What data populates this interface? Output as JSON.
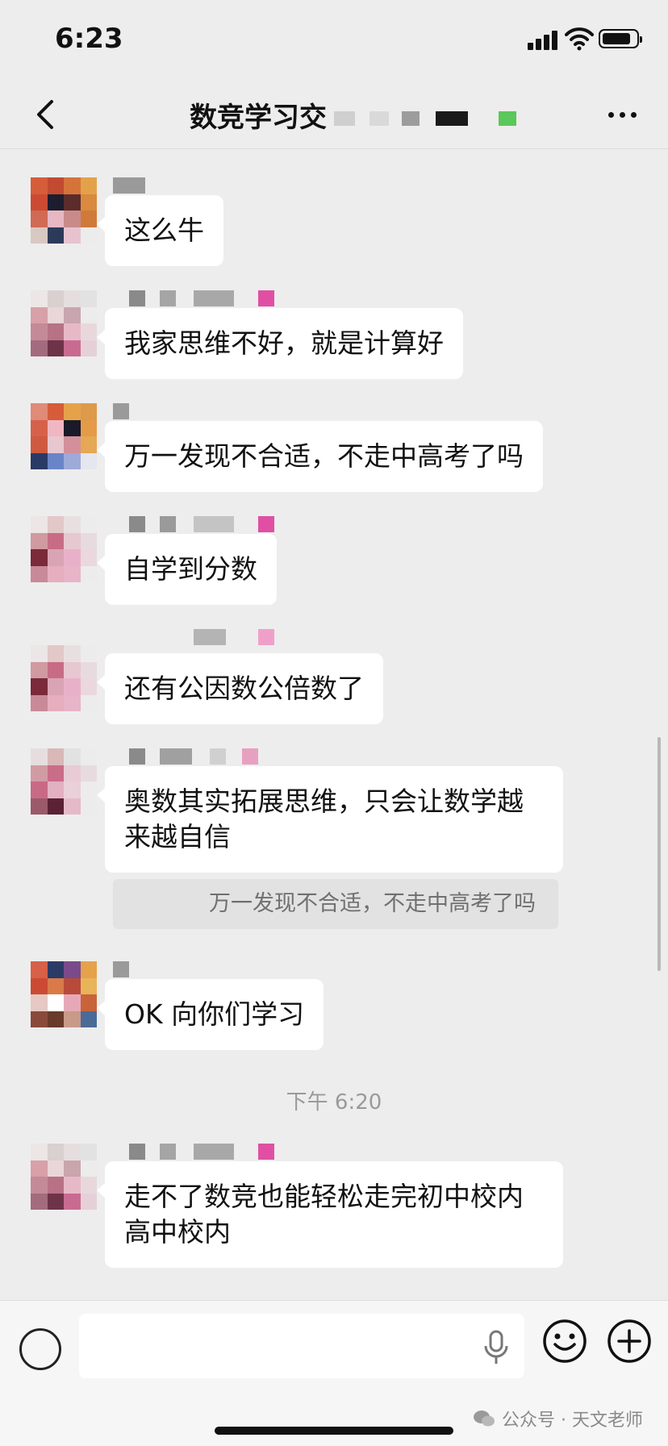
{
  "status": {
    "time": "6:23"
  },
  "chat": {
    "title": "数竞学习交"
  },
  "colors": {
    "background": "#ededed",
    "bubble": "#ffffff",
    "quote": "#e2e2e2",
    "name_tag_pink": "#e04fa3",
    "title_tag_green": "#5ac85a"
  },
  "messages": [
    {
      "text": "这么牛"
    },
    {
      "text": "我家思维不好，就是计算好"
    },
    {
      "text": "万一发现不合适，不走中高考了吗"
    },
    {
      "text": "自学到分数"
    },
    {
      "text": "还有公因数公倍数了"
    },
    {
      "text": "奥数其实拓展思维，只会让数学越来越自信",
      "quote": "万一发现不合适，不走中高考了吗"
    },
    {
      "text": "OK 向你们学习"
    },
    {
      "text": "走不了数竞也能轻松走完初中校内高中校内"
    }
  ],
  "timestamp": "下午 6:20",
  "watermark": {
    "text": "公众号 · 天文老师"
  },
  "icons": [
    "back-icon",
    "more-icon",
    "voice-icon",
    "mic-icon",
    "emoji-icon",
    "plus-icon",
    "wechat-icon"
  ]
}
